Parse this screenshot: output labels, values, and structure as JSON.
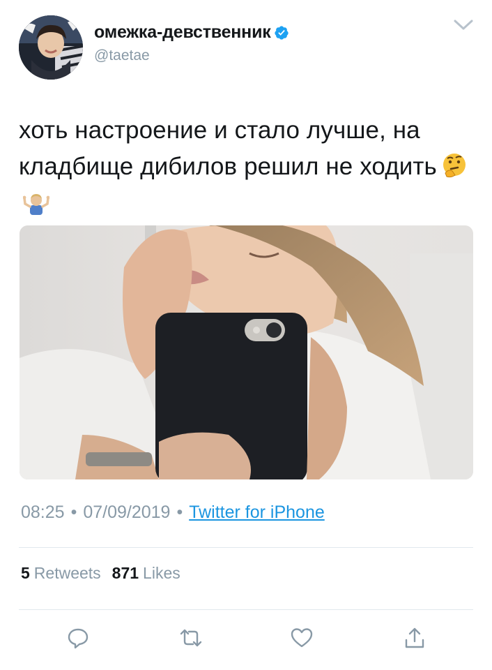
{
  "tweet": {
    "display_name": "омежка-девственник",
    "handle": "@taetae",
    "text": "хоть настроение и стало лучше, на кладбище дибилов решил не ходить",
    "time": "08:25",
    "date": "07/09/2019",
    "separator": "•",
    "source": "Twitter for iPhone",
    "retweets_count": "5",
    "retweets_label": "Retweets",
    "likes_count": "871",
    "likes_label": "Likes"
  },
  "icons": {
    "verified": "verified-badge-icon",
    "menu": "chevron-down-icon",
    "reply": "reply-icon",
    "retweet": "retweet-icon",
    "like": "heart-icon",
    "share": "share-icon",
    "emoji_1": "thinking-face-emoji",
    "emoji_2": "person-shrugging-emoji"
  },
  "colors": {
    "text": "#14171a",
    "secondary": "#8899a6",
    "link": "#1b95e0",
    "verified": "#1da1f2",
    "divider": "#e1e8ed"
  }
}
